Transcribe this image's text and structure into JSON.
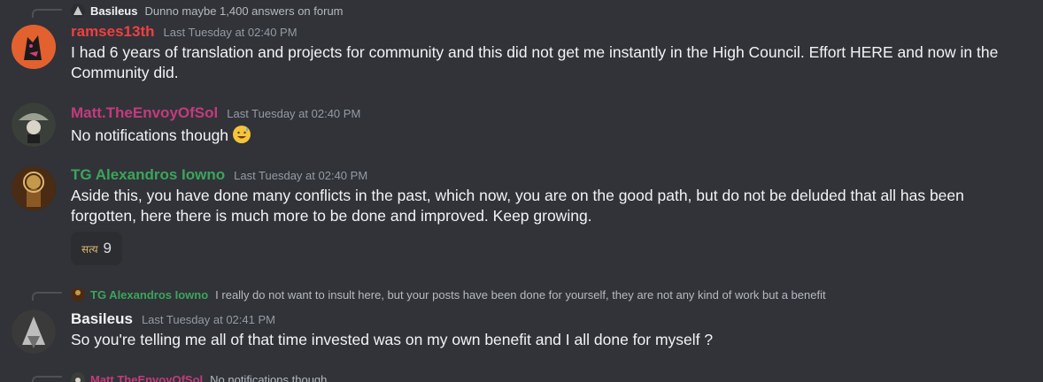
{
  "messages": [
    {
      "reply": {
        "name": "Basileus",
        "text": "Dunno maybe 1,400 answers on forum"
      },
      "author": "ramses13th",
      "time": "Last Tuesday at 02:40 PM",
      "text": "I had 6 years of translation and projects for community and this did not get me instantly in the High Council. Effort HERE and now in the Community did."
    },
    {
      "author": "Matt.TheEnvoyOfSol",
      "time": "Last Tuesday at 02:40 PM",
      "text": "No notifications though"
    },
    {
      "author": "TG Alexandros Iowno",
      "time": "Last Tuesday at 02:40 PM",
      "text": "Aside this, you have done many conflicts in the past, which now, you are on the good path, but do not be deluded that all has been forgotten, here there is much more to be done and improved. Keep growing.",
      "reaction": {
        "emoji": "सत्य",
        "count": "9"
      }
    },
    {
      "reply": {
        "name": "TG Alexandros Iowno",
        "text": "I really do not want to insult here, but your posts have been done for yourself, they are not any kind of work but a benefit"
      },
      "author": "Basileus",
      "time": "Last Tuesday at 02:41 PM",
      "text": "So you're telling me all of that time invested was on my own benefit and I all done for myself ?"
    },
    {
      "reply": {
        "name": "Matt.TheEnvoyOfSol",
        "text": "No notifications though"
      }
    }
  ],
  "colors": {
    "ramses13th": "#f23f42",
    "matt": "#c43b7d",
    "alexandros": "#3ba55c",
    "basileus": "#f2f3f5"
  }
}
